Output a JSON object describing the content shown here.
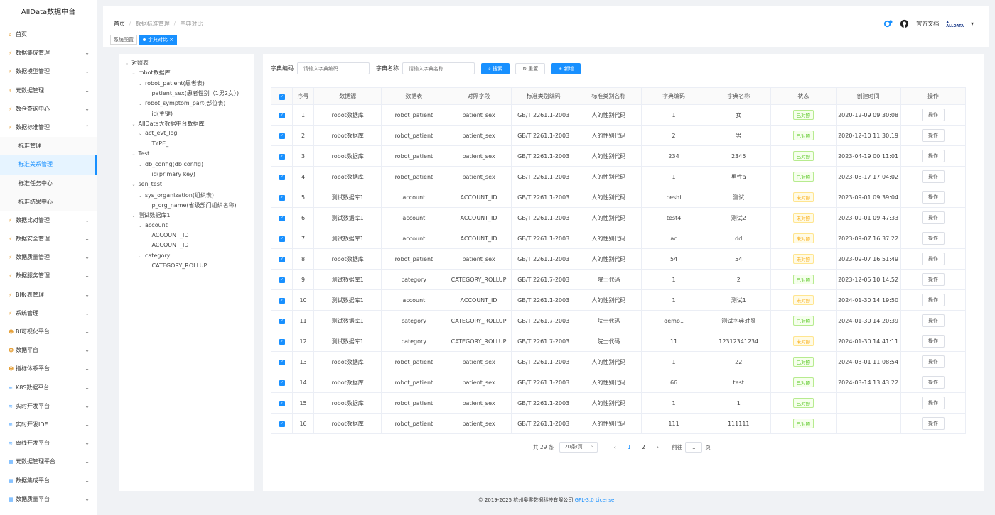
{
  "app_title": "AllData数据中台",
  "sidebar": {
    "items": [
      {
        "label": "首页",
        "icon": "home-icon",
        "chev": ""
      },
      {
        "label": "数据集成管理",
        "icon": "bolt-icon",
        "chev": "⌄"
      },
      {
        "label": "数据模型管理",
        "icon": "bolt-icon",
        "chev": "⌄"
      },
      {
        "label": "元数据管理",
        "icon": "bolt-icon",
        "chev": "⌄"
      },
      {
        "label": "数仓查询中心",
        "icon": "bolt-icon",
        "chev": "⌄"
      },
      {
        "label": "数据标准管理",
        "icon": "bolt-icon",
        "chev": "⌃"
      }
    ],
    "sub_items": [
      "标准管理",
      "标准关系管理",
      "标准任务中心",
      "标准结果中心"
    ],
    "items2": [
      {
        "label": "数据比对管理",
        "icon": "bolt-icon",
        "chev": "⌄"
      },
      {
        "label": "数据安全管理",
        "icon": "bolt-icon",
        "chev": "⌄"
      },
      {
        "label": "数据质量管理",
        "icon": "bolt-icon",
        "chev": "⌄"
      },
      {
        "label": "数据服务管理",
        "icon": "bolt-icon",
        "chev": "⌄"
      },
      {
        "label": "BI报表管理",
        "icon": "bolt-icon",
        "chev": "⌄"
      },
      {
        "label": "系统管理",
        "icon": "bolt-icon",
        "chev": "⌄"
      },
      {
        "label": "BI可视化平台",
        "icon": "person-icon",
        "chev": "⌄"
      },
      {
        "label": "数据平台",
        "icon": "person-icon",
        "chev": "⌄"
      },
      {
        "label": "指标体系平台",
        "icon": "person-icon",
        "chev": "⌄"
      },
      {
        "label": "K8S数据平台",
        "icon": "wave-icon",
        "chev": "⌄"
      },
      {
        "label": "实时开发平台",
        "icon": "wave-icon",
        "chev": "⌄"
      },
      {
        "label": "实时开发IDE",
        "icon": "wave-icon",
        "chev": "⌄"
      },
      {
        "label": "离线开发平台",
        "icon": "wave-icon",
        "chev": "⌄"
      },
      {
        "label": "元数据管理平台",
        "icon": "grid-icon",
        "chev": "⌄"
      },
      {
        "label": "数据集成平台",
        "icon": "grid-icon",
        "chev": "⌄"
      },
      {
        "label": "数据质量平台",
        "icon": "grid-icon",
        "chev": "⌄"
      }
    ]
  },
  "header": {
    "breadcrumb": [
      "首页",
      "数据标准管理",
      "字典对比"
    ],
    "tags": [
      "系统配置",
      "字典对比"
    ],
    "docs_label": "官方文档",
    "avatar_text": "ALLDATA"
  },
  "tree": [
    {
      "label": "对照表",
      "arrow": "⌄",
      "indent": 0
    },
    {
      "label": "robot数据库",
      "arrow": "⌄",
      "indent": 1
    },
    {
      "label": "robot_patient(患者表)",
      "arrow": "⌄",
      "indent": 2
    },
    {
      "label": "patient_sex(患者性别（1男2女）)",
      "arrow": "",
      "indent": 3
    },
    {
      "label": "robot_symptom_part(部位表)",
      "arrow": "⌄",
      "indent": 2
    },
    {
      "label": "id(主键)",
      "arrow": "",
      "indent": 3
    },
    {
      "label": "AllData大数据中台数据库",
      "arrow": "⌄",
      "indent": 1
    },
    {
      "label": "act_evt_log",
      "arrow": "⌄",
      "indent": 2
    },
    {
      "label": "TYPE_",
      "arrow": "",
      "indent": 3
    },
    {
      "label": "Test",
      "arrow": "⌄",
      "indent": 1
    },
    {
      "label": "db_config(db config)",
      "arrow": "⌄",
      "indent": 2
    },
    {
      "label": "id(primary key)",
      "arrow": "",
      "indent": 3
    },
    {
      "label": "sen_test",
      "arrow": "⌄",
      "indent": 1
    },
    {
      "label": "sys_organization(组织表)",
      "arrow": "⌄",
      "indent": 2
    },
    {
      "label": "p_org_name(省级部门组织名称)",
      "arrow": "",
      "indent": 3
    },
    {
      "label": "测试数据库1",
      "arrow": "⌄",
      "indent": 1
    },
    {
      "label": "account",
      "arrow": "⌄",
      "indent": 2
    },
    {
      "label": "ACCOUNT_ID",
      "arrow": "",
      "indent": 3
    },
    {
      "label": "ACCOUNT_ID",
      "arrow": "",
      "indent": 3
    },
    {
      "label": "category",
      "arrow": "⌄",
      "indent": 2
    },
    {
      "label": "CATEGORY_ROLLUP",
      "arrow": "",
      "indent": 3
    }
  ],
  "search": {
    "code_label": "字典编码",
    "code_placeholder": "请输入字典编码",
    "name_label": "字典名称",
    "name_placeholder": "请输入字典名称",
    "search_btn": "搜索",
    "reset_btn": "重置",
    "add_btn": "新增"
  },
  "table": {
    "columns": [
      "",
      "序号",
      "数据源",
      "数据表",
      "对照字段",
      "标准类别编码",
      "标准类别名称",
      "字典编码",
      "字典名称",
      "状态",
      "创建时间",
      "操作"
    ],
    "rows": [
      [
        "1",
        "robot数据库",
        "robot_patient",
        "patient_sex",
        "GB/T 2261.1-2003",
        "人的性别代码",
        "1",
        "女",
        "已对照",
        "2020-12-09 09:30:08"
      ],
      [
        "2",
        "robot数据库",
        "robot_patient",
        "patient_sex",
        "GB/T 2261.1-2003",
        "人的性别代码",
        "2",
        "男",
        "已对照",
        "2020-12-10 11:30:19"
      ],
      [
        "3",
        "robot数据库",
        "robot_patient",
        "patient_sex",
        "GB/T 2261.1-2003",
        "人的性别代码",
        "234",
        "2345",
        "已对照",
        "2023-04-19 00:11:01"
      ],
      [
        "4",
        "robot数据库",
        "robot_patient",
        "patient_sex",
        "GB/T 2261.1-2003",
        "人的性别代码",
        "1",
        "男性a",
        "已对照",
        "2023-08-17 17:04:02"
      ],
      [
        "5",
        "测试数据库1",
        "account",
        "ACCOUNT_ID",
        "GB/T 2261.1-2003",
        "人的性别代码",
        "ceshi",
        "测试",
        "未对照",
        "2023-09-01 09:39:04"
      ],
      [
        "6",
        "测试数据库1",
        "account",
        "ACCOUNT_ID",
        "GB/T 2261.1-2003",
        "人的性别代码",
        "test4",
        "测试2",
        "未对照",
        "2023-09-01 09:47:33"
      ],
      [
        "7",
        "测试数据库1",
        "account",
        "ACCOUNT_ID",
        "GB/T 2261.1-2003",
        "人的性别代码",
        "ac",
        "dd",
        "未对照",
        "2023-09-07 16:37:22"
      ],
      [
        "8",
        "robot数据库",
        "robot_patient",
        "patient_sex",
        "GB/T 2261.1-2003",
        "人的性别代码",
        "54",
        "54",
        "未对照",
        "2023-09-07 16:51:49"
      ],
      [
        "9",
        "测试数据库1",
        "category",
        "CATEGORY_ROLLUP",
        "GB/T 2261.7-2003",
        "院士代码",
        "1",
        "2",
        "已对照",
        "2023-12-05 10:14:52"
      ],
      [
        "10",
        "测试数据库1",
        "account",
        "ACCOUNT_ID",
        "GB/T 2261.1-2003",
        "人的性别代码",
        "1",
        "测试1",
        "未对照",
        "2024-01-30 14:19:50"
      ],
      [
        "11",
        "测试数据库1",
        "category",
        "CATEGORY_ROLLUP",
        "GB/T 2261.7-2003",
        "院士代码",
        "demo1",
        "测试字典对照",
        "已对照",
        "2024-01-30 14:20:39"
      ],
      [
        "12",
        "测试数据库1",
        "category",
        "CATEGORY_ROLLUP",
        "GB/T 2261.7-2003",
        "院士代码",
        "11",
        "12312341234",
        "未对照",
        "2024-01-30 14:41:11"
      ],
      [
        "13",
        "robot数据库",
        "robot_patient",
        "patient_sex",
        "GB/T 2261.1-2003",
        "人的性别代码",
        "1",
        "22",
        "已对照",
        "2024-03-01 11:08:54"
      ],
      [
        "14",
        "robot数据库",
        "robot_patient",
        "patient_sex",
        "GB/T 2261.1-2003",
        "人的性别代码",
        "66",
        "test",
        "已对照",
        "2024-03-14 13:43:22"
      ],
      [
        "15",
        "robot数据库",
        "robot_patient",
        "patient_sex",
        "GB/T 2261.1-2003",
        "人的性别代码",
        "1",
        "1",
        "已对照",
        ""
      ],
      [
        "16",
        "robot数据库",
        "robot_patient",
        "patient_sex",
        "GB/T 2261.1-2003",
        "人的性别代码",
        "111",
        "111111",
        "已对照",
        ""
      ]
    ],
    "op_label": "操作",
    "status_ok": "已对照"
  },
  "pagination": {
    "total": "共 29 条",
    "page_size": "20条/页",
    "pages": [
      "1",
      "2"
    ],
    "current": "1",
    "goto_label": "前往",
    "goto_value": "1",
    "page_unit": "页"
  },
  "footer": {
    "copyright": "© 2019-2025 杭州奥零数据科技有限公司",
    "license": "GPL-3.0 License"
  },
  "colors": {
    "primary": "#1890ff",
    "success": "#52c41a",
    "warning": "#faad14"
  }
}
